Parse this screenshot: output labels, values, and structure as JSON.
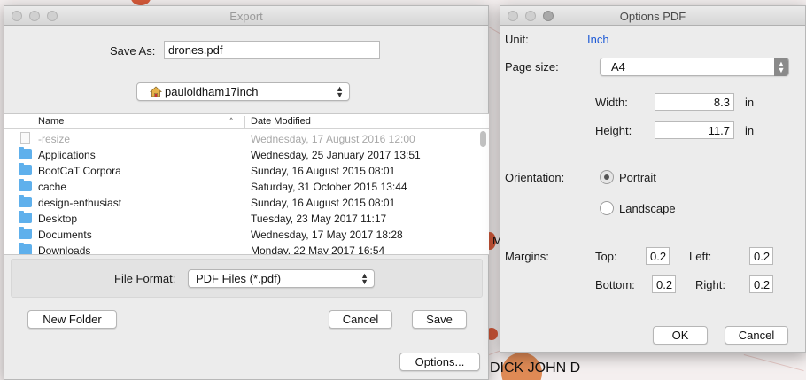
{
  "background": {
    "graph_label_1": "M",
    "graph_label_2": "DICK JOHN D"
  },
  "export_dialog": {
    "title": "Export",
    "save_as_label": "Save As:",
    "save_as_value": "drones.pdf",
    "location": "pauloldham17inch",
    "columns": {
      "name": "Name",
      "date_modified": "Date Modified"
    },
    "files": [
      {
        "name": "-resize",
        "date": "Wednesday, 17 August 2016 12:00",
        "type": "document",
        "dim": true
      },
      {
        "name": "Applications",
        "date": "Wednesday, 25 January 2017 13:51",
        "type": "applications-folder"
      },
      {
        "name": "BootCaT Corpora",
        "date": "Sunday, 16 August 2015 08:01",
        "type": "folder"
      },
      {
        "name": "cache",
        "date": "Saturday, 31 October 2015 13:44",
        "type": "folder"
      },
      {
        "name": "design-enthusiast",
        "date": "Sunday, 16 August 2015 08:01",
        "type": "folder"
      },
      {
        "name": "Desktop",
        "date": "Tuesday, 23 May 2017 11:17",
        "type": "desktop-folder"
      },
      {
        "name": "Documents",
        "date": "Wednesday, 17 May 2017 18:28",
        "type": "documents-folder"
      },
      {
        "name": "Downloads",
        "date": "Monday, 22 May 2017 16:54",
        "type": "downloads-folder"
      }
    ],
    "file_format_label": "File Format:",
    "file_format_value": "PDF Files (*.pdf)",
    "new_folder_label": "New Folder",
    "cancel_label": "Cancel",
    "save_label": "Save",
    "options_label": "Options..."
  },
  "options_dialog": {
    "title": "Options PDF",
    "unit_label": "Unit:",
    "unit_value": "Inch",
    "page_size_label": "Page size:",
    "page_size_value": "A4",
    "width_label": "Width:",
    "width_value": "8.3",
    "height_label": "Height:",
    "height_value": "11.7",
    "unit_suffix": "in",
    "orientation_label": "Orientation:",
    "portrait_label": "Portrait",
    "landscape_label": "Landscape",
    "orientation_selected": "Portrait",
    "margins_label": "Margins:",
    "top_label": "Top:",
    "top_value": "0.2",
    "left_label": "Left:",
    "left_value": "0.2",
    "bottom_label": "Bottom:",
    "bottom_value": "0.2",
    "right_label": "Right:",
    "right_value": "0.2",
    "ok_label": "OK",
    "cancel_label": "Cancel"
  },
  "colors": {
    "link_blue": "#1f5bd6",
    "folder_blue": "#5fb0ec",
    "graph_node": "#d75a3a"
  }
}
